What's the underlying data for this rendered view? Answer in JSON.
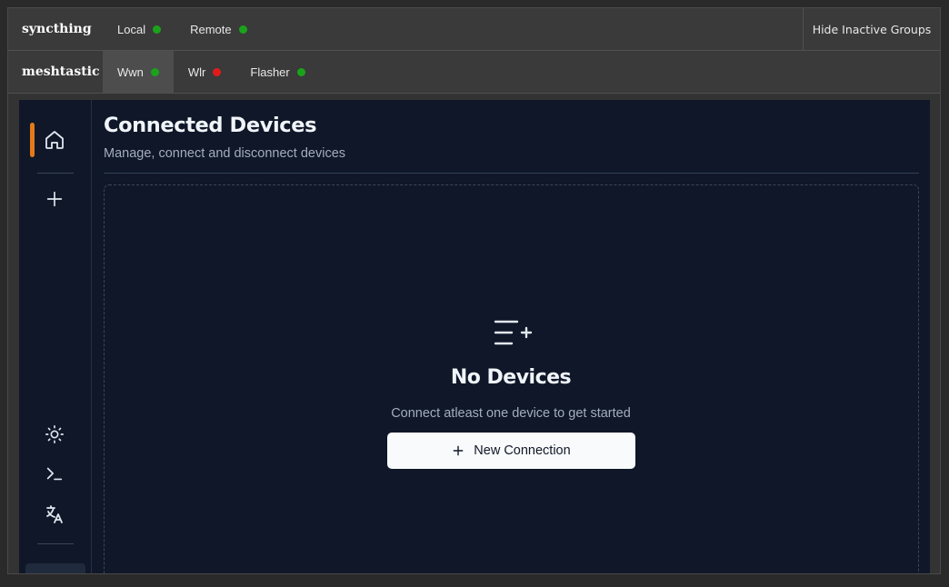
{
  "groups": [
    {
      "name": "syncthing",
      "tabs": [
        {
          "label": "Local",
          "status_color": "#1aa31a"
        },
        {
          "label": "Remote",
          "status_color": "#1aa31a"
        }
      ]
    },
    {
      "name": "meshtastic",
      "tabs": [
        {
          "label": "Wwn",
          "status_color": "#1aa31a",
          "active": true
        },
        {
          "label": "Wlr",
          "status_color": "#e11b1b"
        },
        {
          "label": "Flasher",
          "status_color": "#1aa31a"
        }
      ]
    }
  ],
  "hide_inactive_label": "Hide Inactive Groups",
  "sidebar": {
    "icons": [
      "home-icon",
      "plus-icon",
      "sun-icon",
      "terminal-icon",
      "translate-icon"
    ],
    "accent_color": "#e2791b"
  },
  "page": {
    "title": "Connected Devices",
    "subtitle": "Manage, connect and disconnect devices"
  },
  "empty_state": {
    "icon": "list-plus-icon",
    "title": "No Devices",
    "description": "Connect atleast one device to get started",
    "button_label": "New Connection",
    "button_icon": "plus-icon"
  }
}
